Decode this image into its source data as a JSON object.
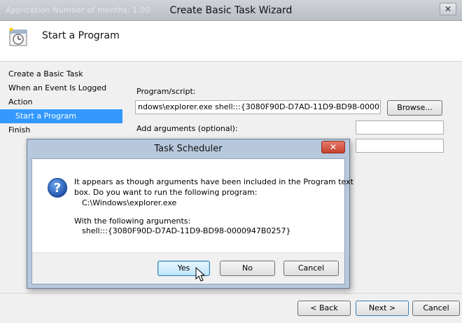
{
  "window": {
    "title": "Create Basic Task Wizard",
    "ghost_title": "Application     Number of months: 1.00",
    "close_glyph": "✕"
  },
  "header": {
    "icon": "task-clock-icon",
    "title": "Start a Program"
  },
  "nav": {
    "items": [
      {
        "label": "Create a Basic Task"
      },
      {
        "label": "When an Event Is Logged"
      },
      {
        "label": "Action"
      },
      {
        "label": "Start a Program"
      },
      {
        "label": "Finish"
      }
    ]
  },
  "form": {
    "program_label": "Program/script:",
    "program_value": "ndows\\explorer.exe shell:::{3080F90D-D7AD-11D9-BD98-0000947B0257}",
    "browse_label": "Browse...",
    "args_label": "Add arguments (optional):",
    "args_value": "",
    "start_value": ""
  },
  "footer": {
    "back_label": "< Back",
    "next_label": "Next >",
    "cancel_label": "Cancel"
  },
  "dialog": {
    "title": "Task Scheduler",
    "close_glyph": "✕",
    "icon": "question-icon",
    "line1": "It appears as though arguments have been included in the Program text",
    "line2": "box. Do you want to run the following program:",
    "program_path": "C:\\Windows\\explorer.exe",
    "line3": "With the following arguments:",
    "arguments": "shell:::{3080F90D-D7AD-11D9-BD98-0000947B0257}",
    "yes_label": "Yes",
    "no_label": "No",
    "cancel_label": "Cancel"
  }
}
